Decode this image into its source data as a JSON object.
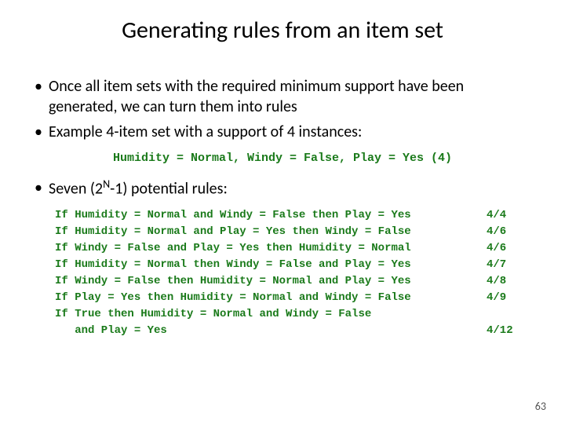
{
  "title": "Generating rules from an item set",
  "bullets": [
    "Once all item sets with the required minimum support have been generated, we can turn them into rules",
    "Example 4-item set with a support of 4 instances:"
  ],
  "itemset_line": "Humidity = Normal, Windy = False, Play = Yes (4)",
  "potential_rules_label_pre": "Seven (2",
  "potential_rules_label_sup": "N",
  "potential_rules_label_post": "-1) potential rules:",
  "rules": [
    {
      "text": "If Humidity = Normal and Windy = False then Play = Yes",
      "ratio": "4/4"
    },
    {
      "text": "If Humidity = Normal and Play = Yes then Windy = False",
      "ratio": "4/6"
    },
    {
      "text": "If Windy = False and Play = Yes then Humidity = Normal",
      "ratio": "4/6"
    },
    {
      "text": "If Humidity = Normal then Windy = False and Play = Yes",
      "ratio": "4/7"
    },
    {
      "text": "If Windy = False then Humidity = Normal and Play = Yes",
      "ratio": "4/8"
    },
    {
      "text": "If Play = Yes then Humidity = Normal and Windy = False",
      "ratio": "4/9"
    },
    {
      "text": "If True then Humidity = Normal and Windy = False\n   and Play = Yes",
      "ratio": "\n4/12"
    }
  ],
  "page_number": "63"
}
